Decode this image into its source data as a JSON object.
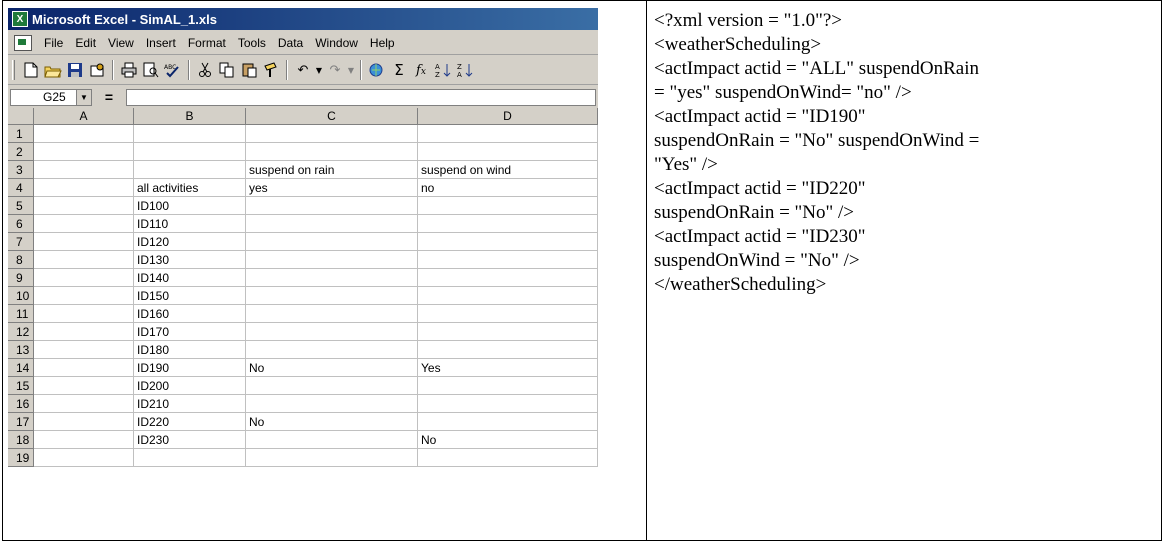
{
  "window": {
    "title": "Microsoft Excel - SimAL_1.xls",
    "app_icon_letter": "X"
  },
  "menu": [
    "File",
    "Edit",
    "View",
    "Insert",
    "Format",
    "Tools",
    "Data",
    "Window",
    "Help"
  ],
  "toolbar": {
    "icons": [
      "new-icon",
      "open-icon",
      "save-icon",
      "permission-icon",
      "print-icon",
      "print-preview-icon",
      "spelling-icon",
      "cut-icon",
      "copy-icon",
      "paste-icon",
      "format-painter-icon",
      "undo-icon",
      "redo-icon",
      "hyperlink-icon",
      "autosum-icon",
      "function-icon",
      "sort-ascending-icon",
      "sort-descending-icon"
    ]
  },
  "formula_bar": {
    "name_box": "G25",
    "equals": "=",
    "value": ""
  },
  "sheet": {
    "columns": [
      "A",
      "B",
      "C",
      "D"
    ],
    "rows": [
      {
        "n": "1",
        "a": "",
        "b": "",
        "c": "",
        "d": ""
      },
      {
        "n": "2",
        "a": "",
        "b": "",
        "c": "",
        "d": ""
      },
      {
        "n": "3",
        "a": "",
        "b": "",
        "c": "suspend on rain",
        "d": "suspend on wind"
      },
      {
        "n": "4",
        "a": "",
        "b": "all activities",
        "c": "yes",
        "d": "no"
      },
      {
        "n": "5",
        "a": "",
        "b": "ID100",
        "c": "",
        "d": ""
      },
      {
        "n": "6",
        "a": "",
        "b": "ID110",
        "c": "",
        "d": ""
      },
      {
        "n": "7",
        "a": "",
        "b": "ID120",
        "c": "",
        "d": ""
      },
      {
        "n": "8",
        "a": "",
        "b": "ID130",
        "c": "",
        "d": ""
      },
      {
        "n": "9",
        "a": "",
        "b": "ID140",
        "c": "",
        "d": ""
      },
      {
        "n": "10",
        "a": "",
        "b": "ID150",
        "c": "",
        "d": ""
      },
      {
        "n": "11",
        "a": "",
        "b": "ID160",
        "c": "",
        "d": ""
      },
      {
        "n": "12",
        "a": "",
        "b": "ID170",
        "c": "",
        "d": ""
      },
      {
        "n": "13",
        "a": "",
        "b": "ID180",
        "c": "",
        "d": ""
      },
      {
        "n": "14",
        "a": "",
        "b": "ID190",
        "c": "No",
        "d": "Yes"
      },
      {
        "n": "15",
        "a": "",
        "b": "ID200",
        "c": "",
        "d": ""
      },
      {
        "n": "16",
        "a": "",
        "b": "ID210",
        "c": "",
        "d": ""
      },
      {
        "n": "17",
        "a": "",
        "b": "ID220",
        "c": "No",
        "d": ""
      },
      {
        "n": "18",
        "a": "",
        "b": "ID230",
        "c": "",
        "d": "No"
      },
      {
        "n": "19",
        "a": "",
        "b": "",
        "c": "",
        "d": ""
      }
    ]
  },
  "xml_lines": [
    "<?xml version = \"1.0\"?>",
    "<weatherScheduling>",
    "<actImpact actid = \"ALL\" suspendOnRain",
    "= \"yes\" suspendOnWind= \"no\" />",
    "<actImpact actid = \"ID190\"",
    "suspendOnRain = \"No\" suspendOnWind =",
    "\"Yes\" />",
    "<actImpact actid = \"ID220\"",
    "suspendOnRain = \"No\" />",
    "<actImpact actid = \"ID230\"",
    "suspendOnWind = \"No\" />",
    "</weatherScheduling>"
  ],
  "colors": {
    "titlebar_start": "#0a246a",
    "titlebar_end": "#3a6ea5",
    "chrome": "#d4d0c8"
  }
}
